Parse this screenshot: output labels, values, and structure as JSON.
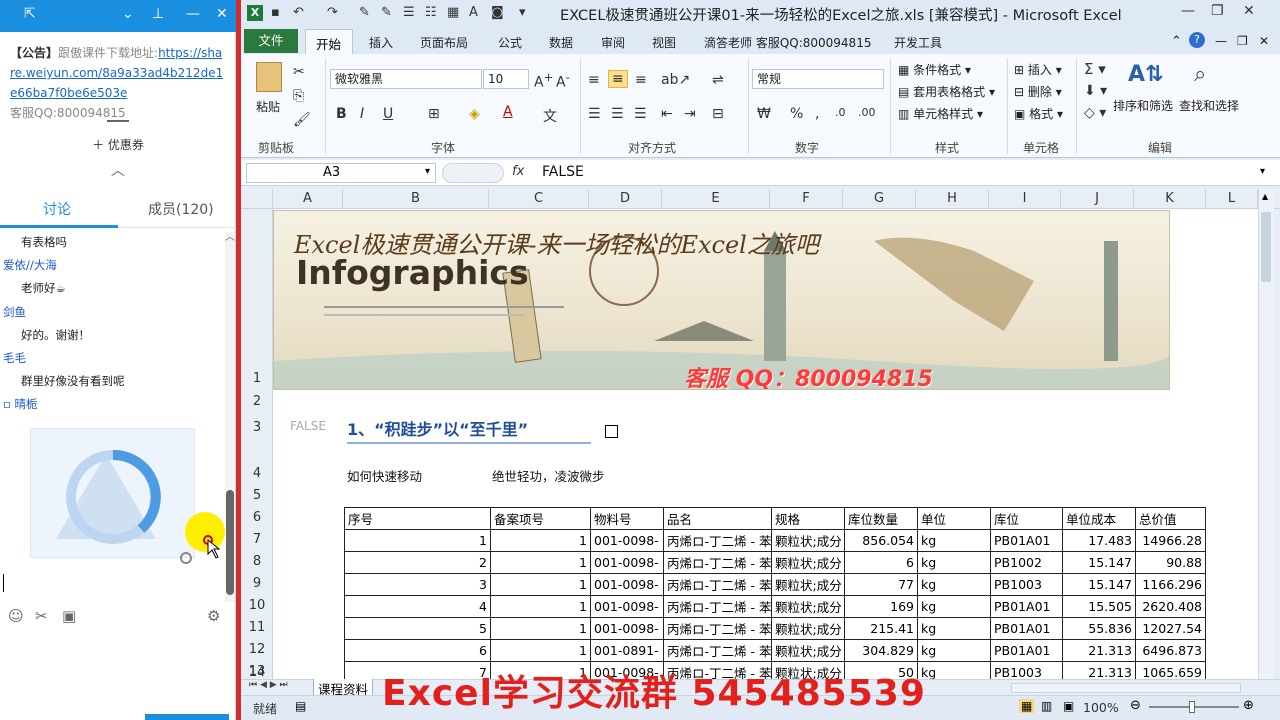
{
  "chat": {
    "notice_label": "【公告】",
    "notice_text": "跟傲课件下载地址:",
    "notice_url": "https://share.weiyun.com/8a9a33ad4b212de1e66ba7f0be6e503e",
    "notice_service": "客服QQ:800094815",
    "coupon": "＋ 优惠券",
    "tabs": [
      "讨论",
      "成员(120)"
    ],
    "messages": [
      {
        "nick": "",
        "text": "有表格吗"
      },
      {
        "nick": "爱依//大海",
        "text": "老师好☕"
      },
      {
        "nick": "剑鱼",
        "text": "好的。谢谢！"
      },
      {
        "nick": "毛毛",
        "text": "群里好像没有看到呢"
      },
      {
        "nick": "晴栀",
        "text": ""
      }
    ]
  },
  "excel": {
    "title": "EXCEL极速贯通班公开课01-来一场轻松的Excel之旅.xls  [兼容模式] - Microsoft Excel",
    "tabs": [
      "文件",
      "开始",
      "插入",
      "页面布局",
      "公式",
      "数据",
      "审阅",
      "视图",
      "滴答老师 客服QQ:800094815",
      "开发工具"
    ],
    "ribbon": {
      "paste": "粘贴",
      "font_name": "微软雅黑",
      "font_size": "10",
      "number_format": "常规",
      "cond_format": "条件格式",
      "table_format": "套用表格格式",
      "cell_style": "单元格样式",
      "insert": "插入",
      "delete": "删除",
      "format": "格式",
      "sort_filter": "排序和筛选",
      "find_select": "查找和选择",
      "groups": [
        "剪贴板",
        "字体",
        "对齐方式",
        "数字",
        "样式",
        "单元格",
        "编辑"
      ]
    },
    "name_box": "A3",
    "formula": "FALSE",
    "columns": [
      "A",
      "B",
      "C",
      "D",
      "E",
      "F",
      "G",
      "H",
      "I",
      "J",
      "K",
      "L"
    ],
    "rows": [
      "1",
      "2",
      "3",
      "4",
      "5",
      "6",
      "7",
      "8",
      "9",
      "10",
      "11",
      "12",
      "13",
      "14"
    ],
    "banner": {
      "title": "Excel极速贯通公开课-来一场轻松的Excel之旅吧",
      "info": "Infographics",
      "qq": "客服 QQ：800094815"
    },
    "a3_value": "FALSE",
    "heading": "1、“积跬步”以“至千里”",
    "row5_left": "如何快速移动",
    "row5_right": "绝世轻功，凌波微步",
    "table": {
      "headers": [
        "序号",
        "备案项号",
        "物料号",
        "品名",
        "规格",
        "库位数量",
        "单位",
        "库位",
        "单位成本",
        "总价值"
      ],
      "rows": [
        [
          "1",
          "1",
          "001-0098-",
          "丙烯ロ-丁二烯 - 苯",
          "颗粒状;成分",
          "856.054",
          "kg",
          "PB01A01",
          "17.483",
          "14966.28"
        ],
        [
          "2",
          "1",
          "001-0098-",
          "丙烯ロ-丁二烯 - 苯",
          "颗粒状;成分",
          "6",
          "kg",
          "PB1002",
          "15.147",
          "90.88"
        ],
        [
          "3",
          "1",
          "001-0098-",
          "丙烯ロ-丁二烯 - 苯",
          "颗粒状;成分",
          "77",
          "kg",
          "PB1003",
          "15.147",
          "1166.296"
        ],
        [
          "4",
          "1",
          "001-0098-",
          "丙烯ロ-丁二烯 - 苯",
          "颗粒状;成分",
          "169",
          "kg",
          "PB01A01",
          "15.505",
          "2620.408"
        ],
        [
          "5",
          "1",
          "001-0098-",
          "丙烯ロ-丁二烯 - 苯",
          "颗粒状;成分",
          "215.41",
          "kg",
          "PB01A01",
          "55.836",
          "12027.54"
        ],
        [
          "6",
          "1",
          "001-0891-",
          "丙烯ロ-丁二烯 - 苯",
          "颗粒状;成分",
          "304.829",
          "kg",
          "PB01A01",
          "21.313",
          "6496.873"
        ],
        [
          "7",
          "1",
          "001-0098-",
          "丙烯ロ-丁二烯 - 苯",
          "颗粒状;成分",
          "50",
          "kg",
          "PB1003",
          "21.313",
          "1065.659"
        ]
      ]
    },
    "sheet_tab": "课程资料",
    "status_ready": "就绪",
    "zoom": "100%",
    "watermark": "Excel学习交流群 545485539"
  }
}
